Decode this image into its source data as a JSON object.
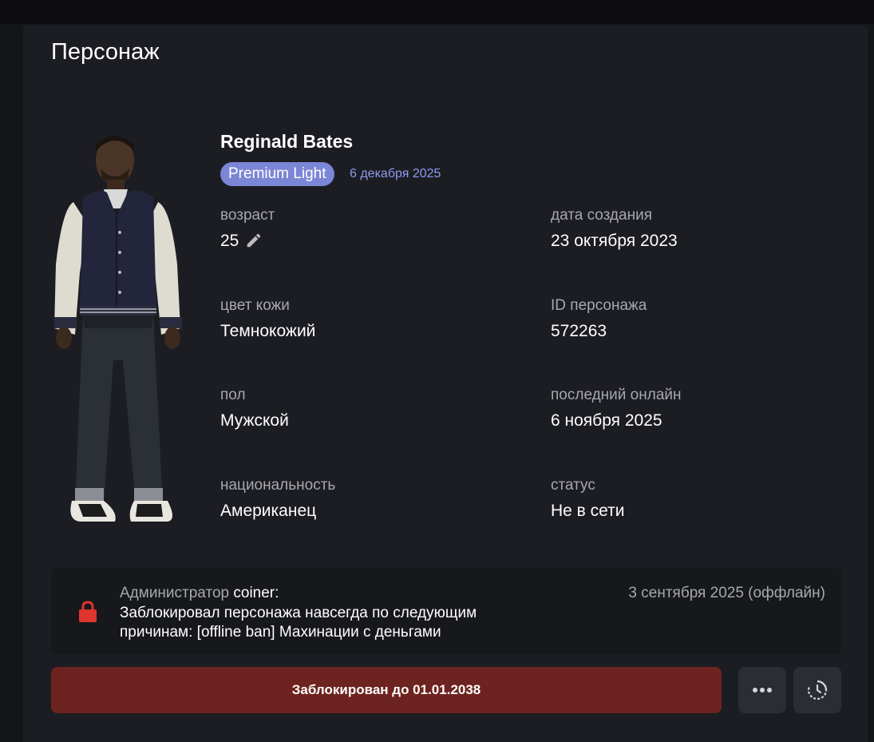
{
  "card": {
    "title": "Персонаж"
  },
  "character": {
    "name": "Reginald Bates",
    "badge": "Premium Light",
    "badge_date": "6 декабря 2025",
    "skin_image": "character-skin"
  },
  "fields": {
    "age": {
      "label": "возраст",
      "value": "25"
    },
    "created": {
      "label": "дата создания",
      "value": "23 октября 2023"
    },
    "skin_color": {
      "label": "цвет кожи",
      "value": "Темнокожий"
    },
    "char_id": {
      "label": "ID персонажа",
      "value": "572263"
    },
    "gender": {
      "label": "пол",
      "value": "Мужской"
    },
    "last_online": {
      "label": "последний онлайн",
      "value": "6 ноября 2025"
    },
    "nationality": {
      "label": "национальность",
      "value": "Американец"
    },
    "status": {
      "label": "статус",
      "value": "Не в сети"
    }
  },
  "ban": {
    "admin_prefix": "Администратор",
    "admin_name": "coiner:",
    "text": "Заблокировал персонажа навсегда по следующим причинам: [offline ban] Махинации с деньгами",
    "date": "3 сентября 2025 (оффлайн)",
    "lock_icon": "lock-icon"
  },
  "actions": {
    "blocked_label": "Заблокирован до 01.01.2038",
    "more_icon": "more-icon",
    "history_icon": "history-icon"
  },
  "colors": {
    "card_bg": "#1c1d22",
    "badge_bg": "#7b86d6",
    "accent_text": "#8e9bf0",
    "danger_bg": "#6d231f",
    "lock_red": "#e0342e"
  }
}
